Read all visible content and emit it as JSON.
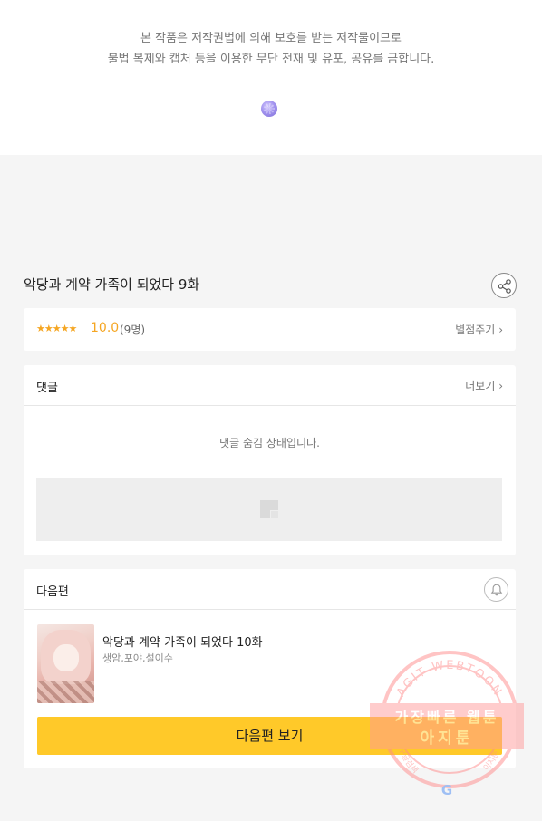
{
  "notice": {
    "line1": "본 작품은 저작권법에 의해 보호를 받는 저작물이므로",
    "line2": "불법 복제와 캡처 등을 이용한 무단 전재 및 유포, 공유를 금합니다."
  },
  "episode": {
    "title": "악당과 계약 가족이 되었다 9화",
    "share_icon": "share-icon"
  },
  "rating": {
    "stars": "★★★★★",
    "score": "10.0",
    "count": "(9명)",
    "rate_label": "별점주기",
    "chevron": "›",
    "accent_color": "#f5a623"
  },
  "comments": {
    "title": "댓글",
    "more_label": "더보기",
    "chevron": "›",
    "hidden_message": "댓글 숨김 상태입니다."
  },
  "next": {
    "title": "다음편",
    "bell_icon": "bell-icon",
    "episode_title": "악당과 계약 가족이 되었다 10화",
    "authors": "생암,포야,설이수",
    "button_label": "다음편 보기",
    "button_color": "#ffc929"
  },
  "watermark": {
    "arc_text": "AGIT WEBTOON",
    "line1": "가장빠른 웹툰",
    "line2": "아지툰",
    "bottom_left": "구글검색",
    "bottom_right": "아지툰",
    "g_mark": "G"
  }
}
